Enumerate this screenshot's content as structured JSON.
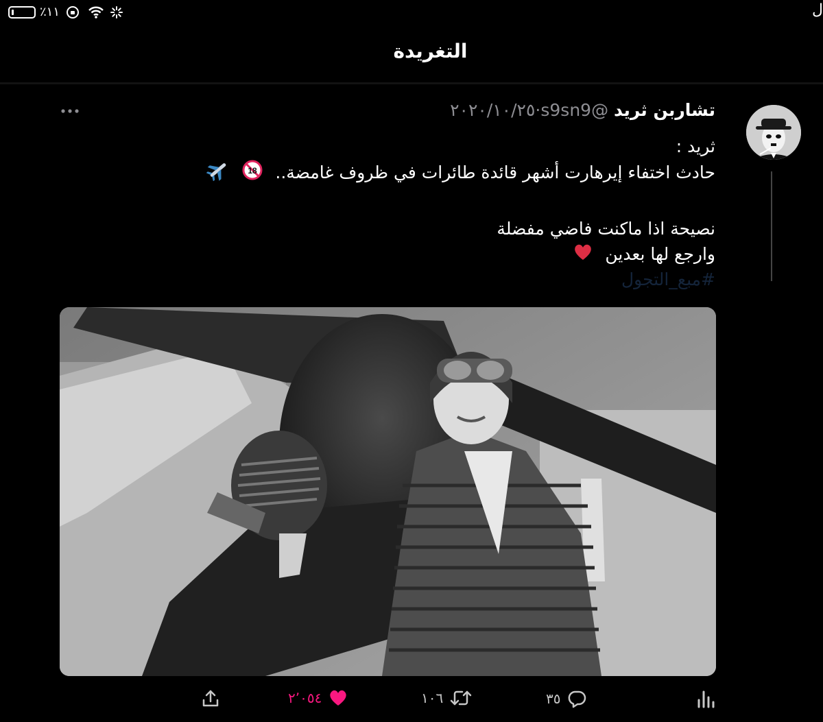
{
  "status_bar": {
    "battery_text": "٪١١",
    "edge_glyph": "ل"
  },
  "header": {
    "title": "التغريدة"
  },
  "tweet": {
    "author_name": "تشاربن ثريد",
    "author_handle": "@s9sn9",
    "separator": "·",
    "date": "٢٠٢٠/١٠/٢٥",
    "body_lines": [
      "ثريد :",
      "حادث اختفاء إيرهارت أشهر قائدة طائرات في ظروف غامضة..",
      "نصيحة اذا ماكنت فاضي مفضلة",
      "وارجع لها بعدين"
    ],
    "hashtag": "#مبع_التجول"
  },
  "actions": {
    "reply_count": "٣٥",
    "retweet_count": "١٠٦",
    "like_count": "٢٬٠٥٤"
  },
  "colors": {
    "background": "#000000",
    "secondary_text": "#8e8e93",
    "like_accent": "#f91880"
  },
  "icons": [
    "wifi-icon",
    "lock-icon",
    "more-icon",
    "analytics-icon",
    "reply-icon",
    "retweet-icon",
    "like-icon",
    "share-icon",
    "airplane-icon",
    "no-under-18-icon",
    "red-heart-icon"
  ]
}
